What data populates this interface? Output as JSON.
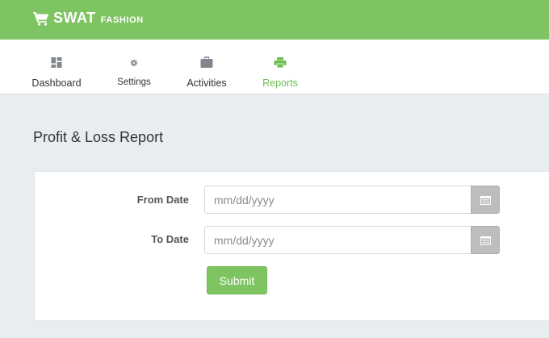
{
  "brand": {
    "main": "SWAT",
    "sub": "FASHION"
  },
  "colors": {
    "accent": "#7fc462",
    "active_nav": "#6dbd52",
    "calendar_button": "#bdbdbd"
  },
  "nav": [
    {
      "label": "Dashboard",
      "icon": "dashboard-icon",
      "active": false
    },
    {
      "label": "Settings",
      "icon": "gear-icon",
      "active": false
    },
    {
      "label": "Activities",
      "icon": "briefcase-icon",
      "active": false
    },
    {
      "label": "Reports",
      "icon": "printer-icon",
      "active": true
    }
  ],
  "page": {
    "title": "Profit & Loss Report"
  },
  "form": {
    "from_label": "From Date",
    "from_placeholder": "mm/dd/yyyy",
    "to_label": "To Date",
    "to_placeholder": "mm/dd/yyyy",
    "submit_label": "Submit"
  }
}
